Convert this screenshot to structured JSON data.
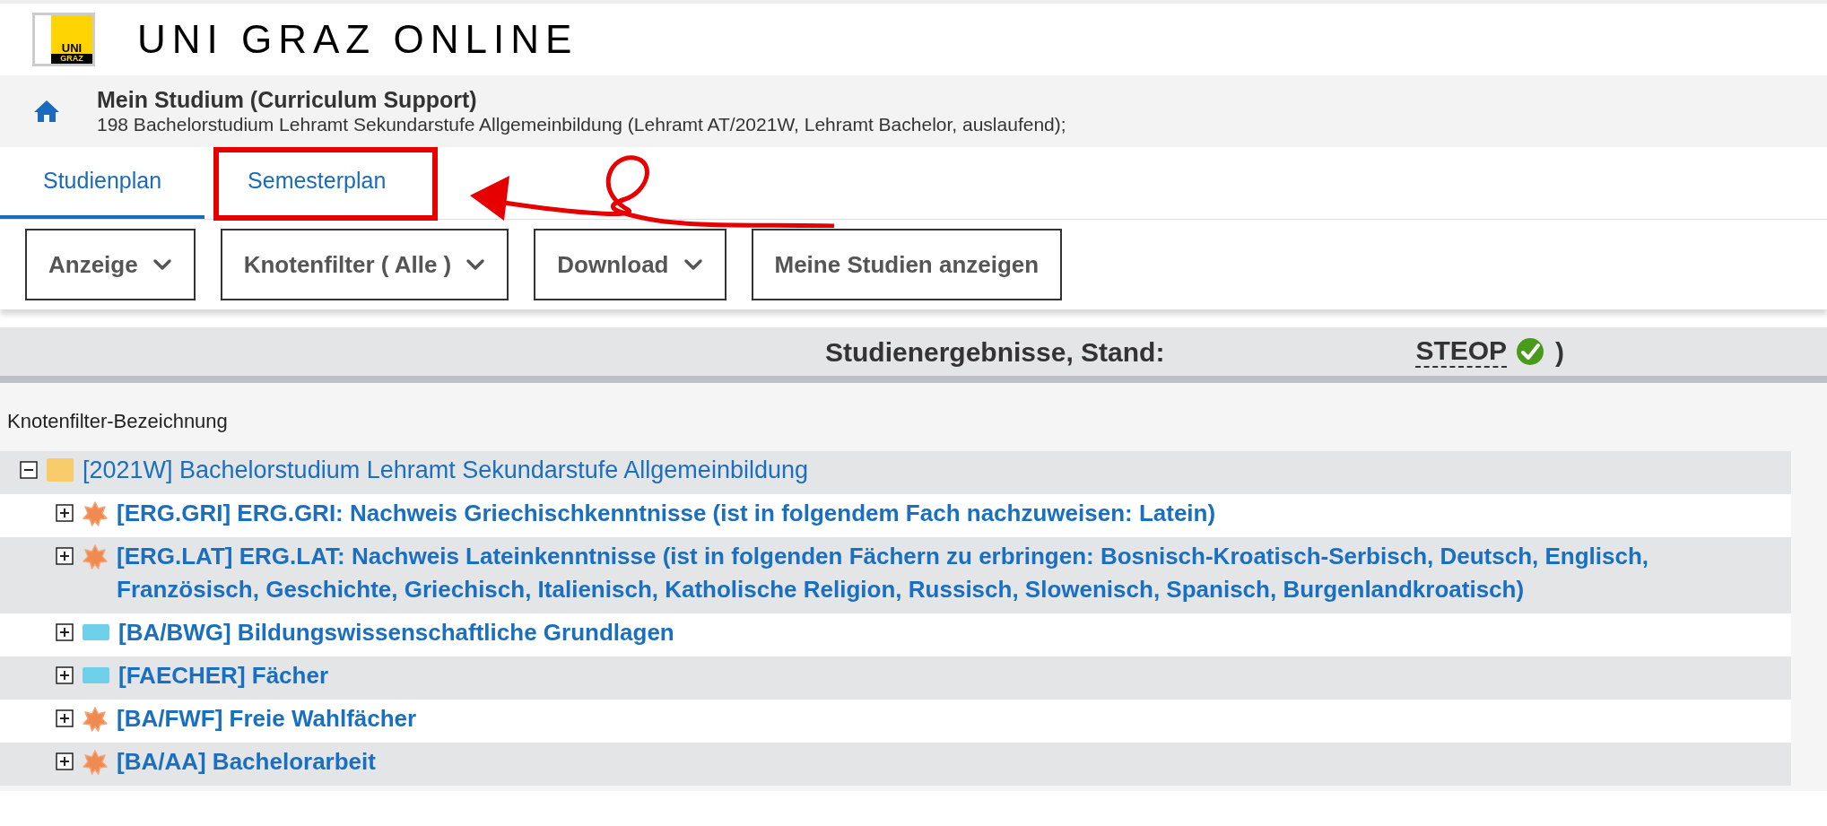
{
  "header": {
    "logo_text": [
      "UNI",
      "GRAZ"
    ],
    "title": "UNI GRAZ ONLINE"
  },
  "breadcrumb": {
    "title": "Mein Studium (Curriculum Support)",
    "subtitle": "198 Bachelorstudium Lehramt Sekundarstufe Allgemeinbildung (Lehramt AT/2021W, Lehramt Bachelor, auslaufend);"
  },
  "tabs": [
    {
      "label": "Studienplan",
      "selected": true,
      "highlighted": false
    },
    {
      "label": "Semesterplan",
      "selected": false,
      "highlighted": true
    }
  ],
  "toolbar": [
    {
      "label": "Anzeige",
      "dropdown": true
    },
    {
      "label": "Knotenfilter ( Alle )",
      "dropdown": true
    },
    {
      "label": "Download",
      "dropdown": true
    },
    {
      "label": "Meine Studien anzeigen",
      "dropdown": false
    }
  ],
  "results_bar": {
    "label": "Studienergebnisse, Stand:",
    "steop": "STEOP",
    "steop_done": true,
    "close": ")"
  },
  "column_header": "Knotenfilter-Bezeichnung",
  "tree": [
    {
      "label": "[2021W] Bachelorstudium Lehramt Sekundarstufe Allgemeinbildung",
      "kind": "folder",
      "expanded": true,
      "children": [
        {
          "label": "[ERG.GRI] ERG.GRI: Nachweis Griechischkenntnisse (ist in folgendem Fach nachzuweisen: Latein)",
          "kind": "star",
          "expanded": false
        },
        {
          "label": "[ERG.LAT] ERG.LAT: Nachweis Lateinkenntnisse (ist in folgenden Fächern zu erbringen: Bosnisch-Kroatisch-Serbisch, Deutsch, Englisch, Französisch, Geschichte, Griechisch, Italienisch, Katholische Religion, Russisch, Slowenisch, Spanisch, Burgenlandkroatisch)",
          "kind": "star",
          "expanded": false
        },
        {
          "label": "[BA/BWG] Bildungswissenschaftliche Grundlagen",
          "kind": "module",
          "expanded": false
        },
        {
          "label": "[FAECHER] Fächer",
          "kind": "module",
          "expanded": false
        },
        {
          "label": "[BA/FWF] Freie Wahlfächer",
          "kind": "star",
          "expanded": false
        },
        {
          "label": "[BA/AA] Bachelorarbeit",
          "kind": "star",
          "expanded": false
        }
      ]
    }
  ]
}
